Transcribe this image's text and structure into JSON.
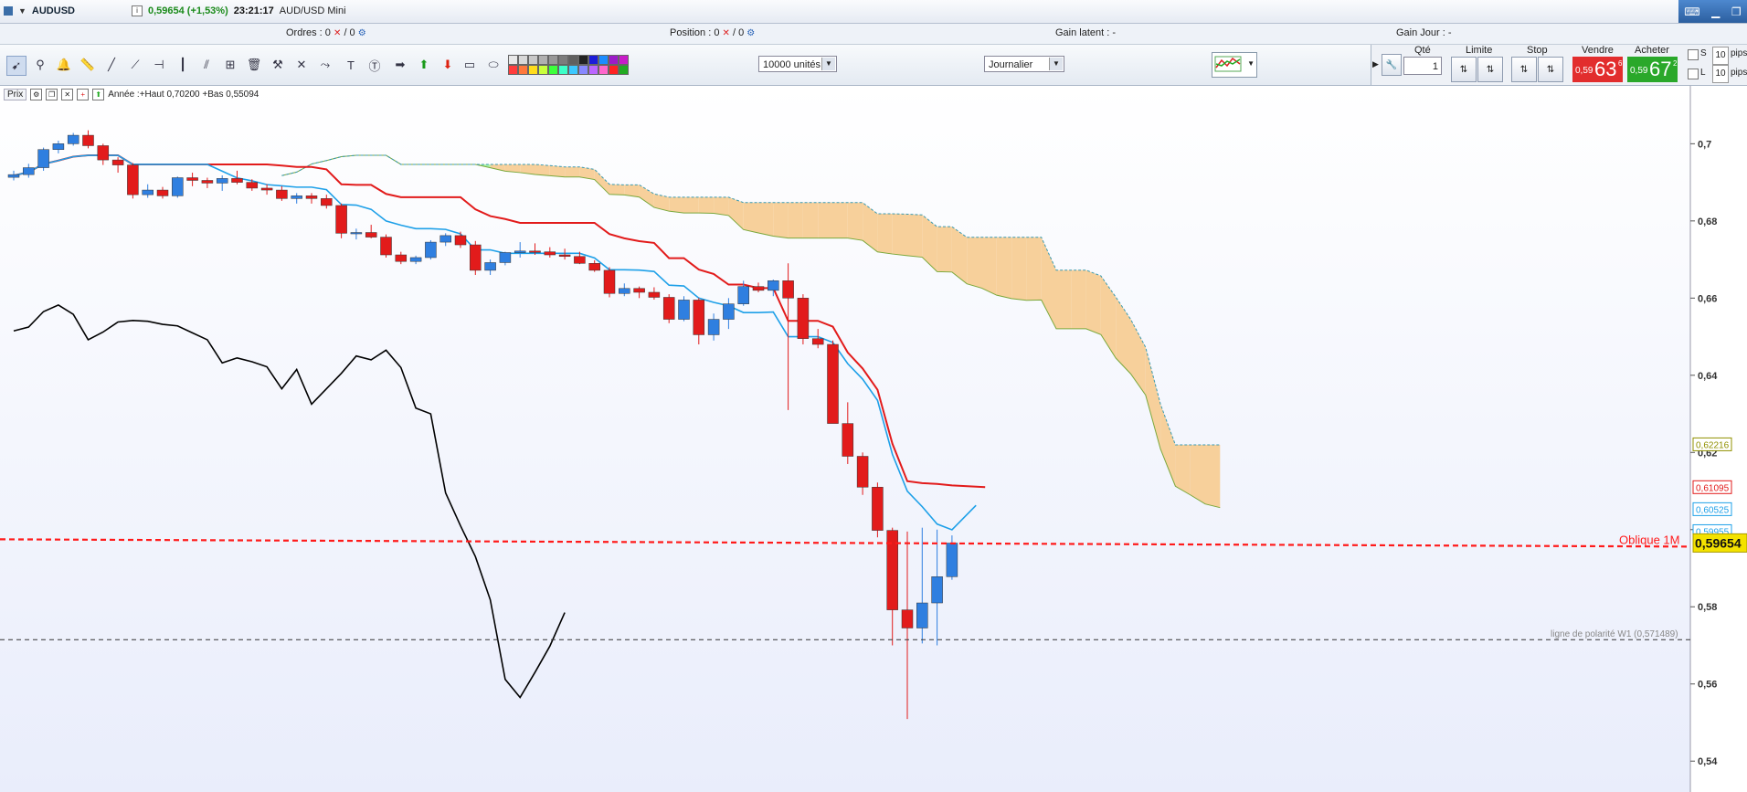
{
  "titlebar": {
    "symbol": "AUDUSD",
    "price_change": "0,59654 (+1,53%)",
    "time": "23:21:17",
    "instrument": "AUD/USD Mini",
    "info": "i"
  },
  "status": {
    "orders_label": "Ordres :",
    "orders_count": "0",
    "orders_total": "/ 0",
    "position_label": "Position :",
    "position_count": "0",
    "position_total": "/ 0",
    "latent_label": "Gain latent : -",
    "day_label": "Gain Jour : -"
  },
  "toolbar": {
    "units": "10000 unités",
    "timeframe": "Journalier",
    "swatch_colors": [
      "#e8e8e8",
      "#d8d8d8",
      "#c8c8c8",
      "#b0b0b0",
      "#989898",
      "#7c7c7c",
      "#606060",
      "#222222",
      "#1c1cd8",
      "#1c8cff",
      "#9c1cc8",
      "#c81cc8",
      "#ff3c3c",
      "#ff783c",
      "#ffdc1c",
      "#c8ff3c",
      "#3cff3c",
      "#3cffc8",
      "#3cc8ff",
      "#8888ff",
      "#bb66ff",
      "#ff66cc",
      "#ff2222",
      "#22aa22"
    ]
  },
  "trade": {
    "qty_label": "Qté",
    "qty_value": "1",
    "limit_label": "Limite",
    "stop_label": "Stop",
    "sell_label": "Vendre",
    "buy_label": "Acheter",
    "sell_small": "0,59",
    "sell_big": "63",
    "sell_sup": "6",
    "buy_small": "0,59",
    "buy_big": "67",
    "buy_sup": "2",
    "s_label": "S",
    "l_label": "L",
    "s_pips": "10",
    "l_pips": "10",
    "pips_label": "pips"
  },
  "chart_header": {
    "prix": "Prix",
    "summary": "Année :+Haut 0,70200 +Bas 0,55094"
  },
  "chart_data": {
    "type": "candlestick",
    "ylim": [
      0.532,
      0.715
    ],
    "y_ticks": [
      "0,7",
      "0,68",
      "0,66",
      "0,64",
      "0,62",
      "0,6",
      "0,58",
      "0,56",
      "0,54"
    ],
    "y_tick_values": [
      0.7,
      0.68,
      0.66,
      0.64,
      0.62,
      0.6,
      0.58,
      0.56,
      0.54
    ],
    "colors": {
      "up": "#2f7fe0",
      "down": "#e21b1b",
      "kijun": "#e21b1b",
      "tenkan": "#1ea0e8",
      "chikou": "#000000",
      "cloud_bear": "#f7d09b",
      "cloud_bull": "#a9f5a9"
    },
    "candles": [
      [
        0.6913,
        0.693,
        0.6905,
        0.692
      ],
      [
        0.692,
        0.6948,
        0.6912,
        0.6938
      ],
      [
        0.6938,
        0.699,
        0.693,
        0.6985
      ],
      [
        0.6985,
        0.7008,
        0.6975,
        0.7
      ],
      [
        0.7,
        0.7028,
        0.6995,
        0.7022
      ],
      [
        0.7022,
        0.7035,
        0.6988,
        0.6995
      ],
      [
        0.6995,
        0.7,
        0.6945,
        0.6958
      ],
      [
        0.6958,
        0.6965,
        0.6925,
        0.6945
      ],
      [
        0.6945,
        0.695,
        0.6858,
        0.6868
      ],
      [
        0.6868,
        0.6895,
        0.686,
        0.688
      ],
      [
        0.688,
        0.6888,
        0.6858,
        0.6865
      ],
      [
        0.6865,
        0.6915,
        0.686,
        0.6912
      ],
      [
        0.6912,
        0.6925,
        0.689,
        0.6905
      ],
      [
        0.6905,
        0.6912,
        0.6885,
        0.6898
      ],
      [
        0.6898,
        0.6918,
        0.6878,
        0.691
      ],
      [
        0.691,
        0.693,
        0.6895,
        0.69
      ],
      [
        0.69,
        0.6908,
        0.6878,
        0.6885
      ],
      [
        0.6885,
        0.6895,
        0.6868,
        0.688
      ],
      [
        0.688,
        0.689,
        0.6852,
        0.6858
      ],
      [
        0.6858,
        0.6872,
        0.6845,
        0.6865
      ],
      [
        0.6865,
        0.6872,
        0.6845,
        0.6858
      ],
      [
        0.6858,
        0.6868,
        0.6832,
        0.684
      ],
      [
        0.684,
        0.6845,
        0.6755,
        0.6768
      ],
      [
        0.6768,
        0.678,
        0.6752,
        0.677
      ],
      [
        0.677,
        0.679,
        0.6755,
        0.6758
      ],
      [
        0.6758,
        0.6765,
        0.6705,
        0.6712
      ],
      [
        0.6712,
        0.672,
        0.6688,
        0.6695
      ],
      [
        0.6695,
        0.671,
        0.6688,
        0.6705
      ],
      [
        0.6705,
        0.675,
        0.67,
        0.6745
      ],
      [
        0.6745,
        0.6768,
        0.6735,
        0.6762
      ],
      [
        0.6762,
        0.6772,
        0.673,
        0.6738
      ],
      [
        0.6738,
        0.6748,
        0.666,
        0.6672
      ],
      [
        0.6672,
        0.67,
        0.666,
        0.6692
      ],
      [
        0.6692,
        0.672,
        0.6685,
        0.6718
      ],
      [
        0.6718,
        0.6745,
        0.6705,
        0.6722
      ],
      [
        0.6722,
        0.6742,
        0.6712,
        0.672
      ],
      [
        0.672,
        0.6732,
        0.6705,
        0.6712
      ],
      [
        0.6712,
        0.6728,
        0.67,
        0.6708
      ],
      [
        0.6708,
        0.672,
        0.6688,
        0.669
      ],
      [
        0.669,
        0.6698,
        0.6668,
        0.6672
      ],
      [
        0.6672,
        0.668,
        0.6602,
        0.6612
      ],
      [
        0.6612,
        0.6638,
        0.6605,
        0.6625
      ],
      [
        0.6625,
        0.663,
        0.66,
        0.6615
      ],
      [
        0.6615,
        0.6628,
        0.6596,
        0.6602
      ],
      [
        0.6602,
        0.661,
        0.6535,
        0.6545
      ],
      [
        0.6545,
        0.6605,
        0.654,
        0.6595
      ],
      [
        0.6595,
        0.66,
        0.648,
        0.6505
      ],
      [
        0.6505,
        0.656,
        0.649,
        0.6545
      ],
      [
        0.6545,
        0.66,
        0.652,
        0.6585
      ],
      [
        0.6585,
        0.6645,
        0.658,
        0.663
      ],
      [
        0.663,
        0.664,
        0.6615,
        0.662
      ],
      [
        0.662,
        0.6648,
        0.6605,
        0.6645
      ],
      [
        0.6645,
        0.669,
        0.631,
        0.66
      ],
      [
        0.66,
        0.661,
        0.648,
        0.6495
      ],
      [
        0.6495,
        0.652,
        0.647,
        0.648
      ],
      [
        0.648,
        0.649,
        0.628,
        0.6275
      ],
      [
        0.6275,
        0.633,
        0.617,
        0.619
      ],
      [
        0.619,
        0.62,
        0.609,
        0.611
      ],
      [
        0.611,
        0.6122,
        0.598,
        0.5998
      ],
      [
        0.5998,
        0.6005,
        0.57,
        0.5792
      ],
      [
        0.5792,
        0.5995,
        0.5509,
        0.5745
      ],
      [
        0.5745,
        0.6005,
        0.5705,
        0.581
      ],
      [
        0.581,
        0.6,
        0.57,
        0.5878
      ],
      [
        0.5878,
        0.5985,
        0.587,
        0.5965
      ]
    ],
    "levels": [
      {
        "value": 0.6221,
        "label": "0,62216",
        "color": "#909000"
      },
      {
        "value": 0.611,
        "label": "0,61095",
        "color": "#e21b1b"
      },
      {
        "value": 0.6053,
        "label": "0,60525",
        "color": "#1ea0e8"
      },
      {
        "value": 0.5996,
        "label": "0,59955",
        "color": "#1ea0e8"
      }
    ],
    "current_price": {
      "value": 0.59654,
      "label": "0,59654"
    },
    "oblique_label": "Oblique 1M",
    "polarity": {
      "value": 0.571489,
      "label": "ligne de polarité W1 (0,571489)"
    }
  }
}
